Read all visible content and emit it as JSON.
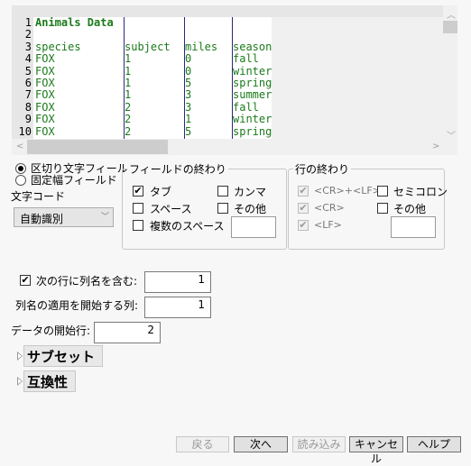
{
  "preview": {
    "line_numbers": [
      "1",
      "2",
      "3",
      "4",
      "5",
      "6",
      "7",
      "8",
      "9",
      "10"
    ],
    "title_line": "Animals Data",
    "columns": [
      {
        "name": "species",
        "values": [
          "FOX",
          "FOX",
          "FOX",
          "FOX",
          "FOX",
          "FOX",
          "FOX"
        ]
      },
      {
        "name": "subject",
        "values": [
          "1",
          "1",
          "1",
          "1",
          "2",
          "2",
          "2"
        ]
      },
      {
        "name": "miles",
        "values": [
          "0",
          "0",
          "5",
          "3",
          "3",
          "1",
          "5"
        ]
      },
      {
        "name": "season",
        "values": [
          "fall",
          "winter",
          "spring",
          "summer",
          "fall",
          "winter",
          "spring"
        ]
      }
    ]
  },
  "field_type": {
    "options": [
      {
        "label": "区切り文字フィールド",
        "selected": true
      },
      {
        "label": "固定幅フィールド",
        "selected": false
      }
    ]
  },
  "encoding": {
    "label": "文字コード",
    "value": "自動識別"
  },
  "field_end": {
    "title": "フィールドの終わり",
    "options": [
      {
        "label": "タブ",
        "checked": true
      },
      {
        "label": "カンマ",
        "checked": false
      },
      {
        "label": "スペース",
        "checked": false
      },
      {
        "label": "その他",
        "checked": false
      },
      {
        "label": "複数のスペース",
        "checked": false
      }
    ],
    "other_value": ""
  },
  "line_end": {
    "title": "行の終わり",
    "options": [
      {
        "label": "<CR>+<LF>",
        "checked": true,
        "disabled": true
      },
      {
        "label": "セミコロン",
        "checked": false
      },
      {
        "label": "<CR>",
        "checked": true,
        "disabled": true
      },
      {
        "label": "その他",
        "checked": false
      },
      {
        "label": "<LF>",
        "checked": true,
        "disabled": true
      }
    ],
    "other_value": ""
  },
  "options": {
    "header_row_label": "次の行に列名を含む:",
    "header_row_checked": true,
    "header_row_value": "1",
    "start_col_label": "列名の適用を開始する列:",
    "start_col_value": "1",
    "data_start_label": "データの開始行:",
    "data_start_value": "2"
  },
  "sections": [
    {
      "label": "サブセット"
    },
    {
      "label": "互換性"
    }
  ],
  "buttons": {
    "back": "戻る",
    "next": "次へ",
    "import": "読み込み",
    "cancel": "キャンセル",
    "help": "ヘルプ"
  }
}
